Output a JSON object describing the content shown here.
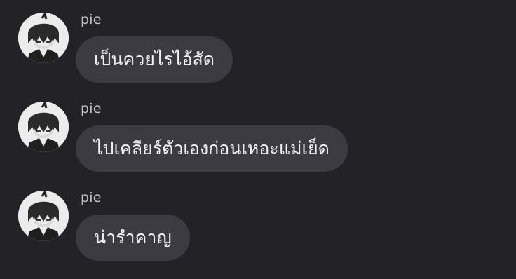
{
  "messages": [
    {
      "sender": "pie",
      "text": "เป็นควยไรไอ้สัด",
      "avatar_icon": "user-avatar-icon"
    },
    {
      "sender": "pie",
      "text": "ไปเคลียร์ตัวเองก่อนเหอะแม่เย็ด",
      "avatar_icon": "user-avatar-icon"
    },
    {
      "sender": "pie",
      "text": "น่ารำคาญ",
      "avatar_icon": "user-avatar-icon"
    }
  ],
  "colors": {
    "background": "#222227",
    "bubble": "#3b3b41",
    "bubble_text": "#f2f2f4",
    "sender_text": "#c4c4c9"
  }
}
